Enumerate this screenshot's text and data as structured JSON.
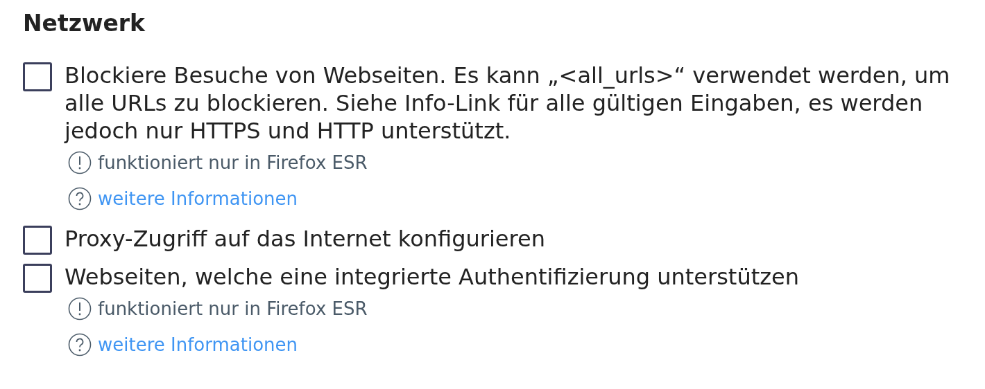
{
  "section": {
    "title": "Netzwerk"
  },
  "options": [
    {
      "label": "Blockiere Besuche von Webseiten. Es kann „<all_urls>“ verwendet werden, um alle URLs zu blockieren. Siehe Info-Link für alle gültigen Eingaben, es werden jedoch nur HTTPS und HTTP unterstützt.",
      "checked": false,
      "notes": [
        {
          "kind": "warning",
          "text": "funktioniert nur in Firefox ESR"
        },
        {
          "kind": "help",
          "text": "weitere Informationen"
        }
      ]
    },
    {
      "label": "Proxy-Zugriff auf das Internet konfigurieren",
      "checked": false
    },
    {
      "label": "Webseiten, welche eine integrierte Authentifizierung unterstützen",
      "checked": false,
      "notes": [
        {
          "kind": "warning",
          "text": "funktioniert nur in Firefox ESR"
        },
        {
          "kind": "help",
          "text": "weitere Informationen"
        }
      ]
    }
  ]
}
